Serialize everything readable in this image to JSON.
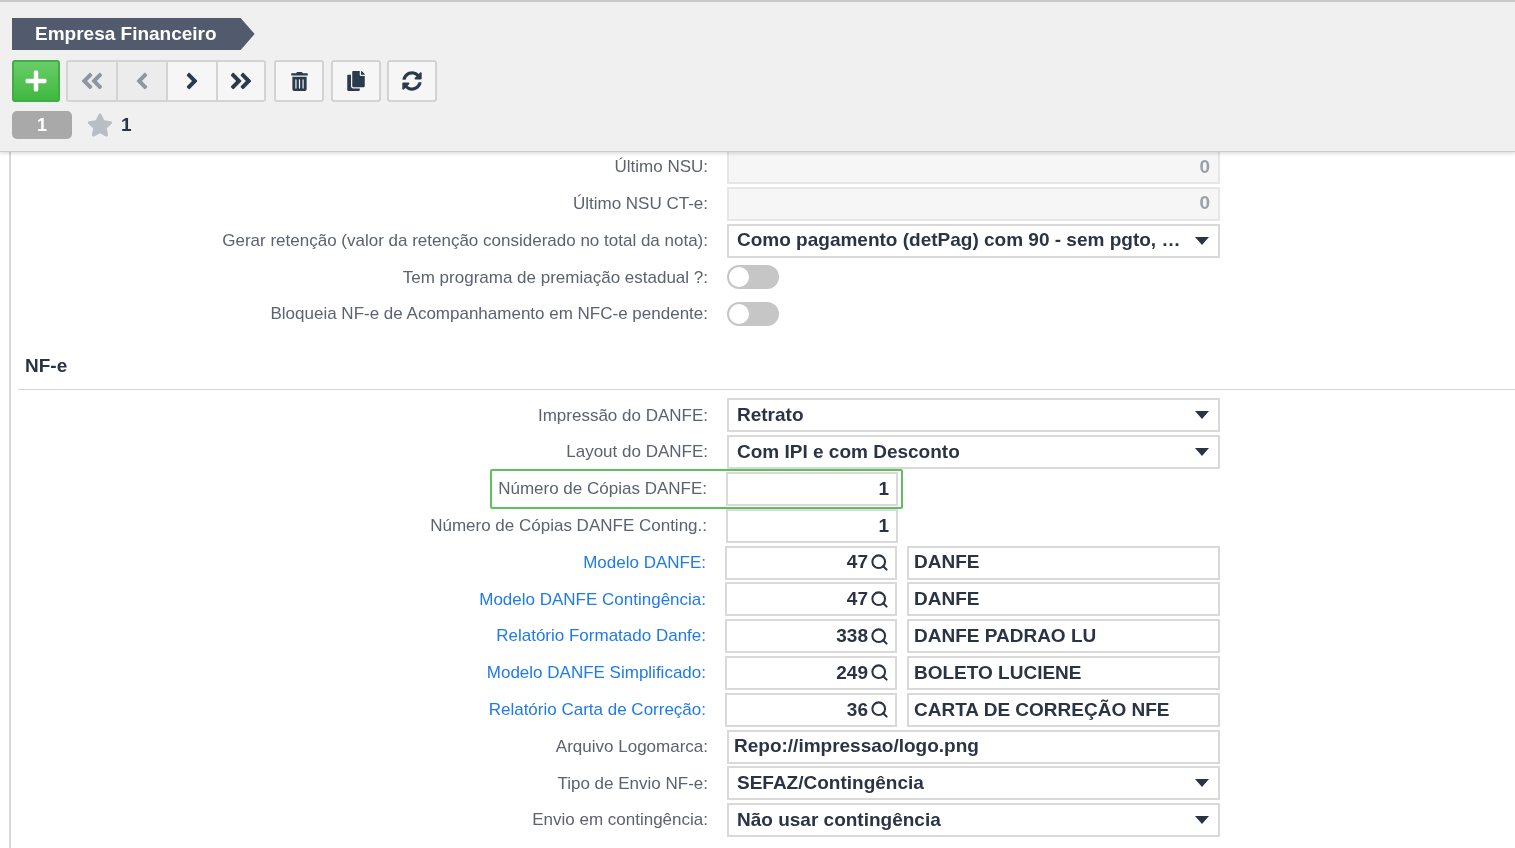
{
  "header": {
    "title": "Empresa Financeiro",
    "toolbar": [
      {
        "kind": "add",
        "disabled": false
      },
      {
        "kind": "first",
        "disabled": true
      },
      {
        "kind": "previous",
        "disabled": true
      },
      {
        "kind": "next",
        "disabled": false
      },
      {
        "kind": "last",
        "disabled": false
      },
      {
        "kind": "delete",
        "disabled": false
      },
      {
        "kind": "copy",
        "disabled": false
      },
      {
        "kind": "refresh",
        "disabled": false
      }
    ],
    "record_count": "1",
    "favorites_count": "1"
  },
  "fields": [
    {
      "kind": "readonly",
      "label": "Último NSU:",
      "value": "0"
    },
    {
      "kind": "readonly",
      "label": "Último NSU CT-e:",
      "value": "0"
    },
    {
      "kind": "select",
      "label": "Gerar retenção (valor da retenção considerado no total da nota):",
      "value": "Como pagamento (detPag) com 90 - sem pgto, …"
    },
    {
      "kind": "toggle",
      "label": "Tem programa de premiação estadual ?:",
      "on": false
    },
    {
      "kind": "toggle",
      "label": "Bloqueia NF-e de Acompanhamento em NFC-e pendente:",
      "on": false
    }
  ],
  "sections": [
    {
      "title": "NF-e",
      "fields": [
        {
          "kind": "select",
          "label": "Impressão do DANFE:",
          "value": "Retrato",
          "highlighted": false
        },
        {
          "kind": "select",
          "label": "Layout do DANFE:",
          "value": "Com IPI e com Desconto",
          "highlighted": false
        },
        {
          "kind": "number",
          "label": "Número de Cópias DANFE:",
          "value": "1",
          "highlighted": true
        },
        {
          "kind": "number",
          "label": "Número de Cópias DANFE Conting.:",
          "value": "1",
          "highlighted": false
        },
        {
          "kind": "lookup",
          "label": "Modelo DANFE:",
          "code": "47",
          "description": "DANFE",
          "highlighted": false
        },
        {
          "kind": "lookup",
          "label": "Modelo DANFE Contingência:",
          "code": "47",
          "description": "DANFE",
          "highlighted": false
        },
        {
          "kind": "lookup",
          "label": "Relatório Formatado Danfe:",
          "code": "338",
          "description": "DANFE PADRAO LU",
          "highlighted": false
        },
        {
          "kind": "lookup",
          "label": "Modelo DANFE Simplificado:",
          "code": "249",
          "description": "BOLETO LUCIENE",
          "highlighted": false
        },
        {
          "kind": "lookup",
          "label": "Relatório Carta de Correção:",
          "code": "36",
          "description": "CARTA DE CORREÇÃO NFE",
          "highlighted": false
        },
        {
          "kind": "text",
          "label": "Arquivo Logomarca:",
          "value": "Repo://impressao/logo.png",
          "highlighted": false
        },
        {
          "kind": "select",
          "label": "Tipo de Envio NF-e:",
          "value": "SEFAZ/Contingência",
          "highlighted": false
        },
        {
          "kind": "select",
          "label": "Envio em contingência:",
          "value": "Não usar contingência",
          "highlighted": false
        }
      ]
    }
  ]
}
